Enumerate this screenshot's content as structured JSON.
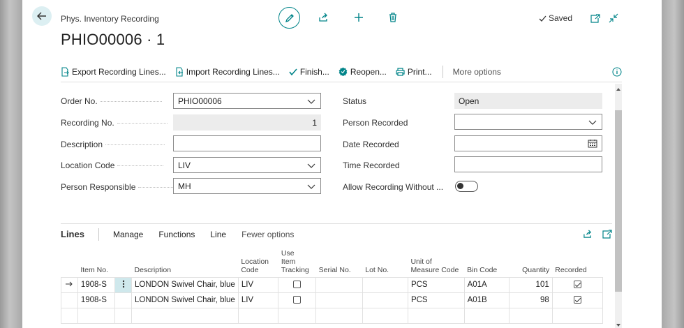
{
  "header": {
    "caption": "Phys. Inventory Recording",
    "title": "PHIO00006 · 1",
    "saved_label": "Saved"
  },
  "actions": {
    "export": "Export Recording Lines...",
    "import": "Import Recording Lines...",
    "finish": "Finish...",
    "reopen": "Reopen...",
    "print": "Print...",
    "more": "More options"
  },
  "form": {
    "order_no": {
      "label": "Order No.",
      "value": "PHIO00006"
    },
    "recording_no": {
      "label": "Recording No.",
      "value": "1"
    },
    "description": {
      "label": "Description",
      "value": ""
    },
    "location_code": {
      "label": "Location Code",
      "value": "LIV"
    },
    "person_responsible": {
      "label": "Person Responsible",
      "value": "MH"
    },
    "status": {
      "label": "Status",
      "value": "Open"
    },
    "person_recorded": {
      "label": "Person Recorded",
      "value": ""
    },
    "date_recorded": {
      "label": "Date Recorded",
      "value": ""
    },
    "time_recorded": {
      "label": "Time Recorded",
      "value": ""
    },
    "allow_recording": {
      "label": "Allow Recording Without ...",
      "value": false
    }
  },
  "lines": {
    "title": "Lines",
    "menu": [
      "Manage",
      "Functions",
      "Line",
      "Fewer options"
    ],
    "columns": {
      "item_no": "Item No.",
      "description": "Description",
      "location_code": [
        "Location",
        "Code"
      ],
      "use_item_tracking": [
        "Use",
        "Item",
        "Tracking"
      ],
      "serial_no": "Serial No.",
      "lot_no": "Lot No.",
      "unit_of_measure": [
        "Unit of",
        "Measure Code"
      ],
      "bin_code": "Bin Code",
      "quantity": "Quantity",
      "recorded": "Recorded"
    },
    "rows": [
      {
        "item_no": "1908-S",
        "description": "LONDON Swivel Chair, blue",
        "location": "LIV",
        "tracking": false,
        "serial": "",
        "lot": "",
        "uom": "PCS",
        "bin": "A01A",
        "quantity": "101",
        "recorded": true
      },
      {
        "item_no": "1908-S",
        "description": "LONDON Swivel Chair, blue",
        "location": "LIV",
        "tracking": false,
        "serial": "",
        "lot": "",
        "uom": "PCS",
        "bin": "A01B",
        "quantity": "98",
        "recorded": true
      }
    ]
  },
  "colors": {
    "accent": "#008489",
    "selection": "#cfe8ec"
  }
}
